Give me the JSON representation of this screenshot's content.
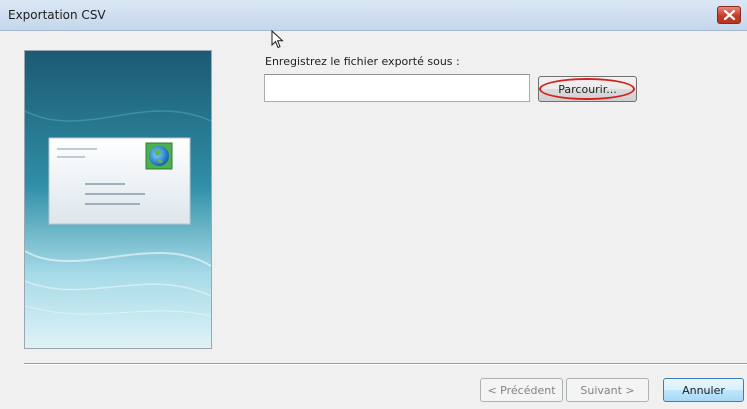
{
  "window": {
    "title": "Exportation CSV"
  },
  "form": {
    "prompt_label": "Enregistrez le fichier exporté sous :",
    "file_path_value": "",
    "browse_label": "Parcourir..."
  },
  "footer": {
    "back_label": "< Précédent",
    "next_label": "Suivant >",
    "cancel_label": "Annuler"
  },
  "state": {
    "back_enabled": false,
    "next_enabled": false,
    "browse_highlighted": true
  },
  "colors": {
    "highlight": "#d4201f",
    "panel_teal": "#1f6f85",
    "close_red": "#c33c25"
  }
}
